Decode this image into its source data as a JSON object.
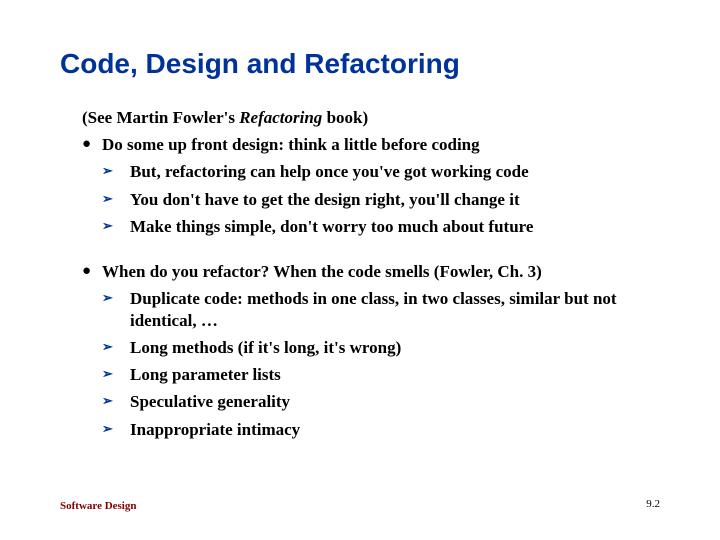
{
  "title": "Code, Design and Refactoring",
  "intro_prefix": "(See Martin Fowler's ",
  "intro_book": "Refactoring",
  "intro_suffix": " book)",
  "bullets": [
    {
      "text": "Do some up front design: think a little before coding",
      "subs": [
        "But, refactoring can help once you've got working code",
        "You don't have to get the design right, you'll change it",
        "Make things simple, don't worry too much about future"
      ]
    },
    {
      "text": "When do you refactor? When the code smells (Fowler, Ch. 3)",
      "subs": [
        "Duplicate code: methods in one class, in two classes, similar but not identical, …",
        "Long methods (if it's long, it's wrong)",
        "Long parameter lists",
        "Speculative generality",
        "Inappropriate intimacy"
      ]
    }
  ],
  "footer_label": "Software Design",
  "footer_page": "9.2"
}
